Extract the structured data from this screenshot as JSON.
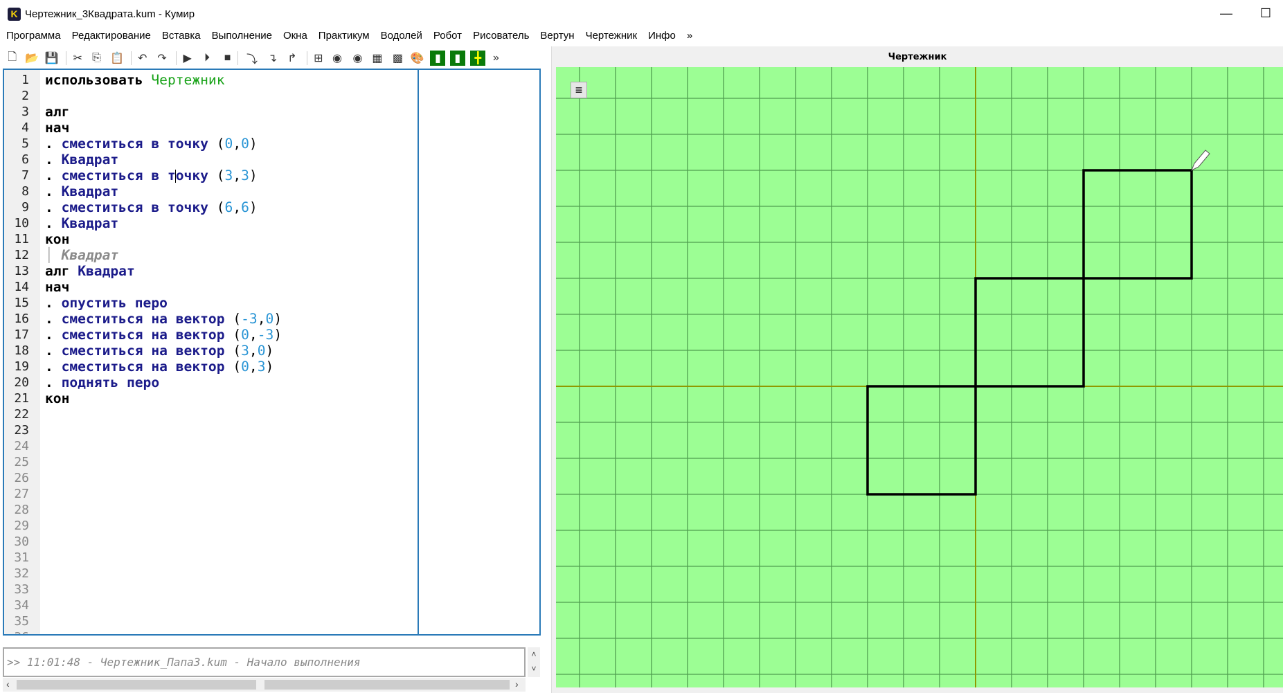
{
  "window": {
    "title": "Чертежник_3Квадрата.kum - Кумир",
    "app_icon": "K",
    "minimize": "—",
    "maximize": "☐"
  },
  "menu": [
    "Программа",
    "Редактирование",
    "Вставка",
    "Выполнение",
    "Окна",
    "Практикум",
    "Водолей",
    "Робот",
    "Рисователь",
    "Вертун",
    "Чертежник",
    "Инфо",
    "»"
  ],
  "toolbar": [
    {
      "icon": "new-file-icon",
      "glyph": "🗋"
    },
    {
      "icon": "open-folder-icon",
      "glyph": "📂"
    },
    {
      "icon": "save-icon",
      "glyph": "💾"
    },
    {
      "icon": "cut-icon",
      "glyph": "✂"
    },
    {
      "icon": "copy-icon",
      "glyph": "⎘"
    },
    {
      "icon": "paste-icon",
      "glyph": "📋"
    },
    {
      "icon": "undo-icon",
      "glyph": "↶"
    },
    {
      "icon": "redo-icon",
      "glyph": "↷"
    },
    {
      "icon": "run-icon",
      "glyph": "▶"
    },
    {
      "icon": "run-step-icon",
      "glyph": "⏵"
    },
    {
      "icon": "stop-icon",
      "glyph": "■"
    },
    {
      "icon": "step-over-icon",
      "glyph": "⤵"
    },
    {
      "icon": "step-into-icon",
      "glyph": "↴"
    },
    {
      "icon": "step-out-icon",
      "glyph": "↱"
    },
    {
      "icon": "variables-icon",
      "glyph": "⊞"
    },
    {
      "icon": "vodoley-icon",
      "glyph": "◉"
    },
    {
      "icon": "vodoley2-icon",
      "glyph": "◉"
    },
    {
      "icon": "robot-icon",
      "glyph": "▦"
    },
    {
      "icon": "robot-remote-icon",
      "glyph": "▩"
    },
    {
      "icon": "painter-icon",
      "glyph": "🎨"
    },
    {
      "icon": "turtle-icon",
      "glyph": "▮"
    },
    {
      "icon": "turtle-remote-icon",
      "glyph": "▮"
    },
    {
      "icon": "draw-icon",
      "glyph": "╋"
    },
    {
      "icon": "more-icon",
      "glyph": "»"
    }
  ],
  "editor": {
    "line_count": 36,
    "cursor": {
      "line": 7,
      "col": 16
    },
    "lines": [
      [
        [
          "использовать ",
          "kw"
        ],
        [
          "Чертежник",
          "mod"
        ]
      ],
      [],
      [
        [
          "алг",
          "kw"
        ]
      ],
      [
        [
          "нач",
          "kw"
        ]
      ],
      [
        [
          ". ",
          "kw"
        ],
        [
          "сместиться в точку ",
          "fn"
        ],
        [
          "(",
          "pu"
        ],
        [
          "0",
          "num"
        ],
        [
          ",",
          "pu"
        ],
        [
          "0",
          "num"
        ],
        [
          ")",
          "pu"
        ]
      ],
      [
        [
          ". ",
          "kw"
        ],
        [
          "Квадрат",
          "fn"
        ]
      ],
      [
        [
          ". ",
          "kw"
        ],
        [
          "сместиться в т",
          "fn"
        ],
        [
          "очку ",
          "fn"
        ],
        [
          "(",
          "pu"
        ],
        [
          "3",
          "num"
        ],
        [
          ",",
          "pu"
        ],
        [
          "3",
          "num"
        ],
        [
          ")",
          "pu"
        ]
      ],
      [
        [
          ". ",
          "kw"
        ],
        [
          "Квадрат",
          "fn"
        ]
      ],
      [
        [
          ". ",
          "kw"
        ],
        [
          "сместиться в точку ",
          "fn"
        ],
        [
          "(",
          "pu"
        ],
        [
          "6",
          "num"
        ],
        [
          ",",
          "pu"
        ],
        [
          "6",
          "num"
        ],
        [
          ")",
          "pu"
        ]
      ],
      [
        [
          ". ",
          "kw"
        ],
        [
          "Квадрат",
          "fn"
        ]
      ],
      [
        [
          "кон",
          "kw"
        ]
      ],
      [
        [
          "│ ",
          "bar"
        ],
        [
          "Квадрат",
          "hint"
        ]
      ],
      [
        [
          "алг ",
          "kw"
        ],
        [
          "Квадрат",
          "fn"
        ]
      ],
      [
        [
          "нач",
          "kw"
        ]
      ],
      [
        [
          ". ",
          "kw"
        ],
        [
          "опустить перо",
          "fn"
        ]
      ],
      [
        [
          ". ",
          "kw"
        ],
        [
          "сместиться на вектор ",
          "fn"
        ],
        [
          "(",
          "pu"
        ],
        [
          "-3",
          "num"
        ],
        [
          ",",
          "pu"
        ],
        [
          "0",
          "num"
        ],
        [
          ")",
          "pu"
        ]
      ],
      [
        [
          ". ",
          "kw"
        ],
        [
          "сместиться на вектор ",
          "fn"
        ],
        [
          "(",
          "pu"
        ],
        [
          "0",
          "num"
        ],
        [
          ",",
          "pu"
        ],
        [
          "-3",
          "num"
        ],
        [
          ")",
          "pu"
        ]
      ],
      [
        [
          ". ",
          "kw"
        ],
        [
          "сместиться на вектор ",
          "fn"
        ],
        [
          "(",
          "pu"
        ],
        [
          "3",
          "num"
        ],
        [
          ",",
          "pu"
        ],
        [
          "0",
          "num"
        ],
        [
          ")",
          "pu"
        ]
      ],
      [
        [
          ". ",
          "kw"
        ],
        [
          "сместиться на вектор ",
          "fn"
        ],
        [
          "(",
          "pu"
        ],
        [
          "0",
          "num"
        ],
        [
          ",",
          "pu"
        ],
        [
          "3",
          "num"
        ],
        [
          ")",
          "pu"
        ]
      ],
      [
        [
          ". ",
          "kw"
        ],
        [
          "поднять перо",
          "fn"
        ]
      ],
      [
        [
          "кон",
          "kw"
        ]
      ]
    ]
  },
  "output": {
    "text": ">> 11:01:48 - Чертежник_Папа3.kum - Начало выполнения",
    "scroll_up": "˄",
    "scroll_down": "˅",
    "scroll_left": "‹",
    "scroll_right": "›"
  },
  "drawer": {
    "title": "Чертежник",
    "menu_icon": "≡",
    "background": "#9cfe94",
    "grid_color": "#4f9f4f",
    "axis_color": "#8f9a00",
    "grid_step": 1,
    "pen_position": [
      6,
      6
    ],
    "paths": [
      [
        [
          0,
          0
        ],
        [
          -3,
          0
        ],
        [
          -3,
          -3
        ],
        [
          0,
          -3
        ],
        [
          0,
          0
        ]
      ],
      [
        [
          3,
          3
        ],
        [
          0,
          3
        ],
        [
          0,
          0
        ],
        [
          3,
          0
        ],
        [
          3,
          3
        ]
      ],
      [
        [
          6,
          6
        ],
        [
          3,
          6
        ],
        [
          3,
          3
        ],
        [
          6,
          3
        ],
        [
          6,
          6
        ]
      ]
    ]
  }
}
